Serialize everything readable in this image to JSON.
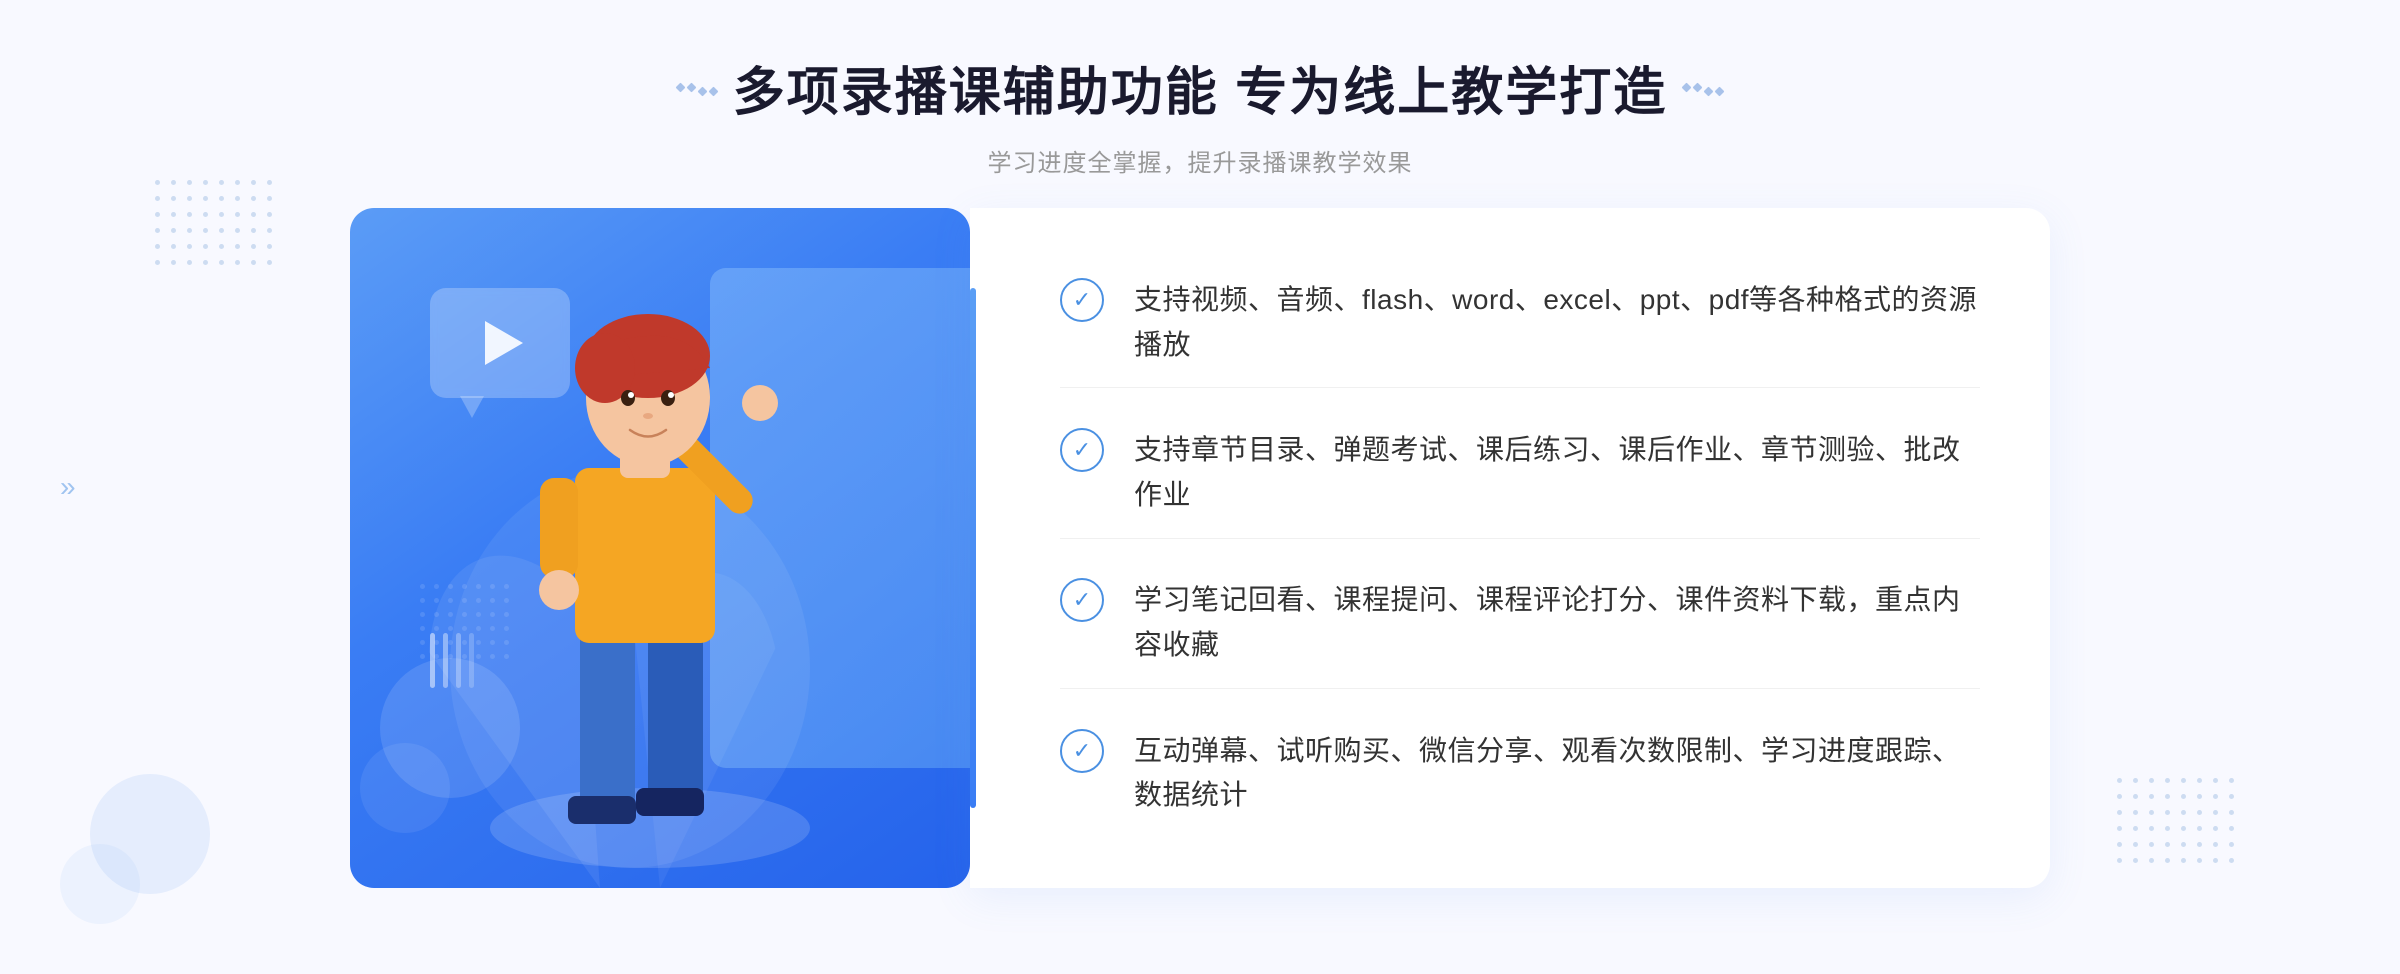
{
  "page": {
    "background": "#f5f7ff"
  },
  "header": {
    "title": "多项录播课辅助功能 专为线上教学打造",
    "subtitle": "学习进度全掌握，提升录播课教学效果",
    "title_deco_left": "⁚",
    "title_deco_right": "⁚"
  },
  "features": [
    {
      "id": 1,
      "text": "支持视频、音频、flash、word、excel、ppt、pdf等各种格式的资源播放"
    },
    {
      "id": 2,
      "text": "支持章节目录、弹题考试、课后练习、课后作业、章节测验、批改作业"
    },
    {
      "id": 3,
      "text": "学习笔记回看、课程提问、课程评论打分、课件资料下载，重点内容收藏"
    },
    {
      "id": 4,
      "text": "互动弹幕、试听购买、微信分享、观看次数限制、学习进度跟踪、数据统计"
    }
  ],
  "illustration": {
    "play_button": "▶"
  },
  "decorations": {
    "left_arrow": "»",
    "check_symbol": "✓"
  },
  "colors": {
    "primary_blue": "#4a90e2",
    "gradient_start": "#5b9cf6",
    "gradient_end": "#2563eb",
    "text_dark": "#1a1a2e",
    "text_gray": "#999999",
    "text_body": "#333333"
  }
}
